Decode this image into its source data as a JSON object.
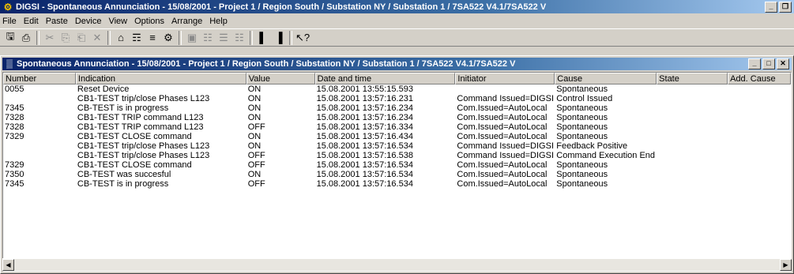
{
  "app": {
    "title": "DIGSI - Spontaneous Annunciation - 15/08/2001 - Project 1 / Region South / Substation NY / Substation 1 / 7SA522 V4.1/7SA522 V"
  },
  "menu": [
    "File",
    "Edit",
    "Paste",
    "Device",
    "View",
    "Options",
    "Arrange",
    "Help"
  ],
  "toolbar": {
    "icons": [
      "save-icon",
      "print-icon",
      "cut-icon",
      "copy-icon",
      "paste-icon",
      "delete-icon",
      "device-icon",
      "tree-icon",
      "compare-icon",
      "stats-icon",
      "list-icon",
      "details-icon",
      "large-icons-icon",
      "small-icons-icon",
      "grid-icon",
      "tile-icon",
      "cascade-icon",
      "help-icon"
    ]
  },
  "child": {
    "title": "Spontaneous Annunciation - 15/08/2001 - Project 1 / Region South / Substation NY / Substation 1 / 7SA522 V4.1/7SA522 V"
  },
  "columns": [
    "Number",
    "Indication",
    "Value",
    "Date and time",
    "Initiator",
    "Cause",
    "State",
    "Add. Cause"
  ],
  "rows": [
    {
      "number": "0055",
      "indication": "Reset Device",
      "value": "ON",
      "datetime": "15.08.2001  13:55:15.593",
      "initiator": "",
      "cause": "Spontaneous",
      "state": "",
      "add_cause": ""
    },
    {
      "number": "",
      "indication": "CB1-TEST trip/close  Phases L123",
      "value": "ON",
      "datetime": "15.08.2001  13:57:16.231",
      "initiator": "Command Issued=DIGSI",
      "cause": "Control Issued",
      "state": "",
      "add_cause": ""
    },
    {
      "number": "7345",
      "indication": "CB-TEST is in progress",
      "value": "ON",
      "datetime": "15.08.2001  13:57:16.234",
      "initiator": "Com.Issued=AutoLocal",
      "cause": "Spontaneous",
      "state": "",
      "add_cause": ""
    },
    {
      "number": "7328",
      "indication": "CB1-TEST TRIP command L123",
      "value": "ON",
      "datetime": "15.08.2001  13:57:16.234",
      "initiator": "Com.Issued=AutoLocal",
      "cause": "Spontaneous",
      "state": "",
      "add_cause": ""
    },
    {
      "number": "7328",
      "indication": "CB1-TEST TRIP command L123",
      "value": "OFF",
      "datetime": "15.08.2001  13:57:16.334",
      "initiator": "Com.Issued=AutoLocal",
      "cause": "Spontaneous",
      "state": "",
      "add_cause": ""
    },
    {
      "number": "7329",
      "indication": "CB1-TEST CLOSE command",
      "value": "ON",
      "datetime": "15.08.2001  13:57:16.434",
      "initiator": "Com.Issued=AutoLocal",
      "cause": "Spontaneous",
      "state": "",
      "add_cause": ""
    },
    {
      "number": "",
      "indication": "CB1-TEST trip/close  Phases L123",
      "value": "ON",
      "datetime": "15.08.2001  13:57:16.534",
      "initiator": "Command Issued=DIGSI",
      "cause": "Feedback Positive",
      "state": "",
      "add_cause": ""
    },
    {
      "number": "",
      "indication": "CB1-TEST trip/close  Phases L123",
      "value": "OFF",
      "datetime": "15.08.2001  13:57:16.538",
      "initiator": "Command Issued=DIGSI",
      "cause": "Command Execution End",
      "state": "",
      "add_cause": ""
    },
    {
      "number": "7329",
      "indication": "CB1-TEST CLOSE command",
      "value": "OFF",
      "datetime": "15.08.2001  13:57:16.534",
      "initiator": "Com.Issued=AutoLocal",
      "cause": "Spontaneous",
      "state": "",
      "add_cause": ""
    },
    {
      "number": "7350",
      "indication": "CB-TEST was succesful",
      "value": "ON",
      "datetime": "15.08.2001  13:57:16.534",
      "initiator": "Com.Issued=AutoLocal",
      "cause": "Spontaneous",
      "state": "",
      "add_cause": ""
    },
    {
      "number": "7345",
      "indication": "CB-TEST is in progress",
      "value": "OFF",
      "datetime": "15.08.2001  13:57:16.534",
      "initiator": "Com.Issued=AutoLocal",
      "cause": "Spontaneous",
      "state": "",
      "add_cause": ""
    }
  ]
}
